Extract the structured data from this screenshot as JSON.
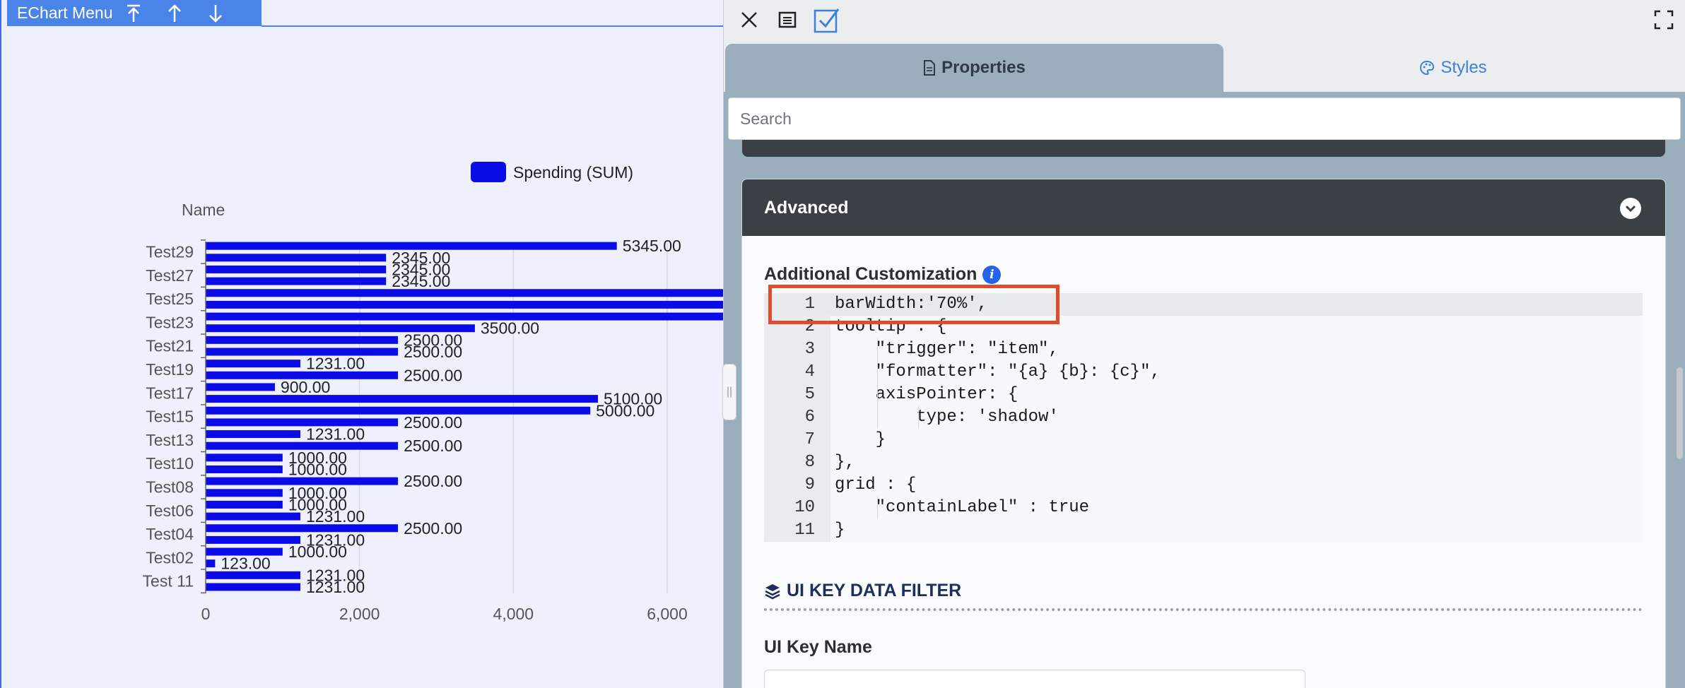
{
  "chart_menu": {
    "title": "EChart Menu",
    "up_top": "⭱",
    "up": "↑",
    "down": "↓"
  },
  "chart_data": {
    "type": "bar",
    "orientation": "horizontal",
    "legend": [
      "Spending (SUM)"
    ],
    "legend_position": "top-right",
    "ylabel": "Name",
    "y_tick_labels": [
      "Test 11",
      "Test02",
      "Test04",
      "Test06",
      "Test08",
      "Test10",
      "Test13",
      "Test15",
      "Test17",
      "Test19",
      "Test21",
      "Test23",
      "Test25",
      "Test27",
      "Test29"
    ],
    "x_ticks": [
      "0",
      "2,000",
      "4,000",
      "6,000"
    ],
    "xlim": [
      0,
      6850
    ],
    "grid": true,
    "bar_color": "#0b0be8",
    "bars": [
      {
        "value": 1231,
        "label": "1231.00"
      },
      {
        "value": 1231,
        "label": "1231.00"
      },
      {
        "value": 123,
        "label": "123.00"
      },
      {
        "value": 1000,
        "label": "1000.00"
      },
      {
        "value": 1231,
        "label": "1231.00"
      },
      {
        "value": 2500,
        "label": "2500.00"
      },
      {
        "value": 1231,
        "label": "1231.00"
      },
      {
        "value": 1000,
        "label": "1000.00"
      },
      {
        "value": 1000,
        "label": "1000.00"
      },
      {
        "value": 2500,
        "label": "2500.00"
      },
      {
        "value": 1000,
        "label": "1000.00"
      },
      {
        "value": 1000,
        "label": "1000.00"
      },
      {
        "value": 2500,
        "label": "2500.00"
      },
      {
        "value": 1231,
        "label": "1231.00"
      },
      {
        "value": 2500,
        "label": "2500.00"
      },
      {
        "value": 5000,
        "label": "5000.00"
      },
      {
        "value": 5100,
        "label": "5100.00"
      },
      {
        "value": 900,
        "label": "900.00"
      },
      {
        "value": 2500,
        "label": "2500.00"
      },
      {
        "value": 1231,
        "label": "1231.00"
      },
      {
        "value": 2500,
        "label": "2500.00"
      },
      {
        "value": 2500,
        "label": "2500.00"
      },
      {
        "value": 3500,
        "label": "3500.00"
      },
      {
        "value": 6850,
        "label": ""
      },
      {
        "value": 6850,
        "label": ""
      },
      {
        "value": 6850,
        "label": ""
      },
      {
        "value": 2345,
        "label": "2345.00"
      },
      {
        "value": 2345,
        "label": "2345.00"
      },
      {
        "value": 2345,
        "label": "2345.00"
      },
      {
        "value": 5345,
        "label": "5345.00"
      }
    ]
  },
  "toolbar": {
    "close_icon": "×"
  },
  "tabs": {
    "properties": "Properties",
    "styles": "Styles"
  },
  "search": {
    "placeholder": "Search"
  },
  "advanced": {
    "title": "Advanced",
    "custom_label": "Additional Customization",
    "info": "i",
    "code_lines": [
      {
        "n": "1",
        "text": "barWidth:'70%',"
      },
      {
        "n": "2",
        "text": "tooltip : {"
      },
      {
        "n": "3",
        "text": "    \"trigger\": \"item\","
      },
      {
        "n": "4",
        "text": "    \"formatter\": \"{a} {b}: {c}\","
      },
      {
        "n": "5",
        "text": "    axisPointer: {"
      },
      {
        "n": "6",
        "text": "        type: 'shadow'"
      },
      {
        "n": "7",
        "text": "    }"
      },
      {
        "n": "8",
        "text": "},"
      },
      {
        "n": "9",
        "text": "grid : {"
      },
      {
        "n": "10",
        "text": "    \"containLabel\" : true"
      },
      {
        "n": "11",
        "text": "}"
      }
    ]
  },
  "filter": {
    "heading": "UI KEY DATA FILTER",
    "key_label": "UI Key Name"
  }
}
